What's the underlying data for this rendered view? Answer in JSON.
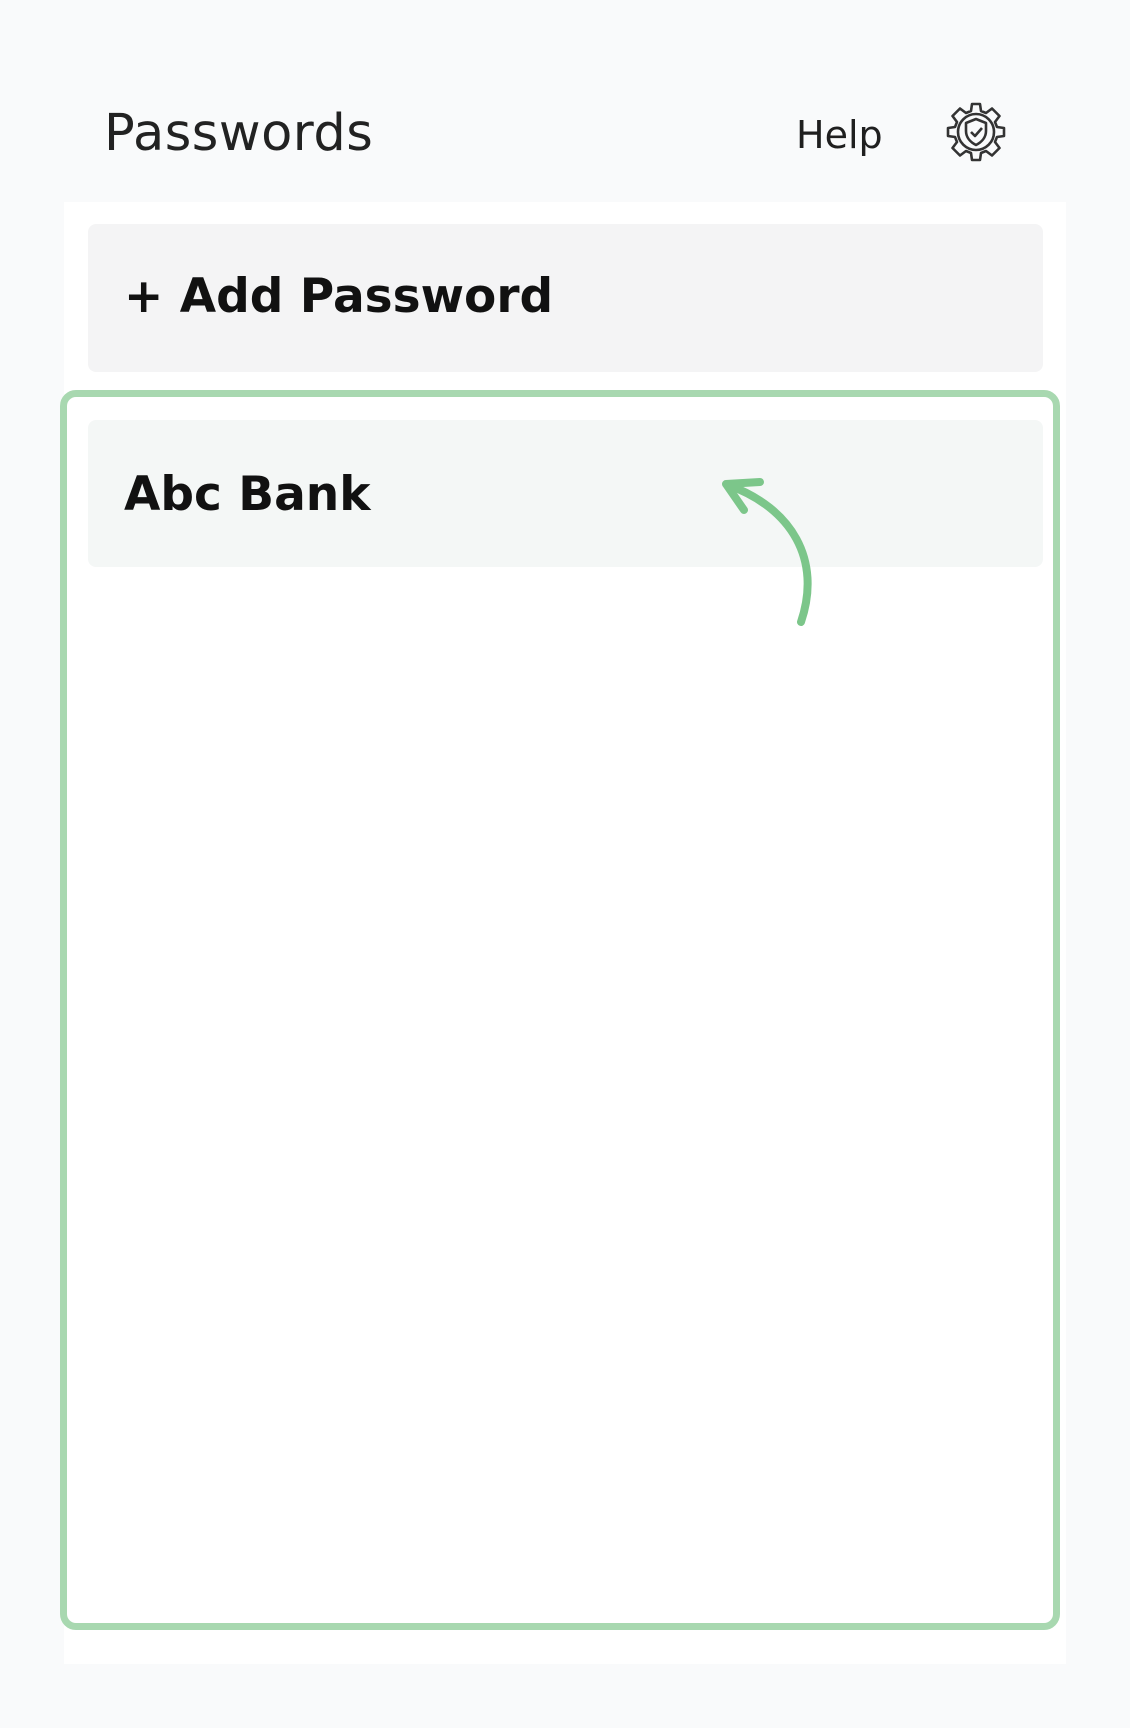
{
  "header": {
    "title": "Passwords",
    "help_label": "Help",
    "settings_icon": "gear-shield-icon"
  },
  "actions": {
    "add_password_label": "+ Add Password"
  },
  "passwords": [
    {
      "name": "Abc Bank"
    }
  ],
  "annotation": {
    "highlight_color": "#a8d8b0",
    "arrow_color": "#7cc68a",
    "arrow_icon": "curved-arrow-icon"
  }
}
